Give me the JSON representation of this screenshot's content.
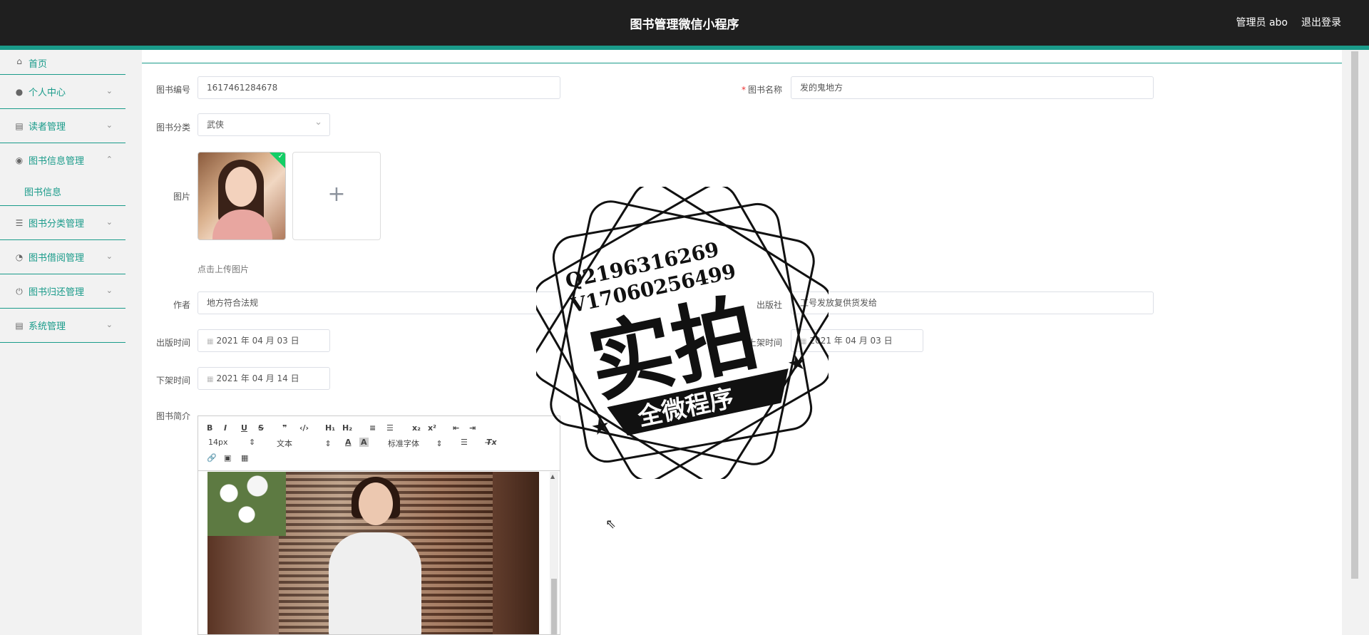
{
  "header": {
    "title": "图书管理微信小程序",
    "admin_label": "管理员 abo",
    "logout_label": "退出登录"
  },
  "sidebar": {
    "items": [
      {
        "label": "首页",
        "icon": "home-icon"
      },
      {
        "label": "个人中心",
        "icon": "user-icon"
      },
      {
        "label": "读者管理",
        "icon": "clipboard-icon"
      },
      {
        "label": "图书信息管理",
        "icon": "bulb-icon"
      },
      {
        "label": "图书分类管理",
        "icon": "list-icon"
      },
      {
        "label": "图书借阅管理",
        "icon": "gauge-icon"
      },
      {
        "label": "图书归还管理",
        "icon": "power-icon"
      },
      {
        "label": "系统管理",
        "icon": "clipboard-icon"
      }
    ],
    "sub_item": "图书信息"
  },
  "form": {
    "book_no_label": "图书编号",
    "book_no_value": "1617461284678",
    "book_name_label": "图书名称",
    "book_name_value": "发的鬼地方",
    "category_label": "图书分类",
    "category_value": "武侠",
    "image_label": "图片",
    "upload_plus": "+",
    "upload_hint": "点击上传图片",
    "author_label": "作者",
    "author_value": "地方符合法规",
    "publisher_label": "出版社",
    "publisher_value": "工号发放复供货发给",
    "publish_date_label": "出版时间",
    "publish_date_value": "2021 年 04 月 03 日",
    "shelf_date_label": "上架时间",
    "shelf_date_value": "2021 年 04 月 03 日",
    "offshelf_date_label": "下架时间",
    "offshelf_date_value": "2021 年 04 月 14 日",
    "intro_label": "图书简介"
  },
  "editor": {
    "buttons_row1": [
      "B",
      "I",
      "U",
      "S",
      "❞",
      "‹/›",
      "H₁",
      "H₂",
      "≡",
      "☰",
      "x₂",
      "x²",
      "⇤",
      "⇥"
    ],
    "font_size": "14px",
    "text_style": "文本",
    "font_family": "标准字体",
    "clear_format": "T̶x"
  },
  "watermark": {
    "line1": "Q2196316269",
    "line2": "V17060256499",
    "big_text": "实拍",
    "banner_text": "全微程序"
  }
}
